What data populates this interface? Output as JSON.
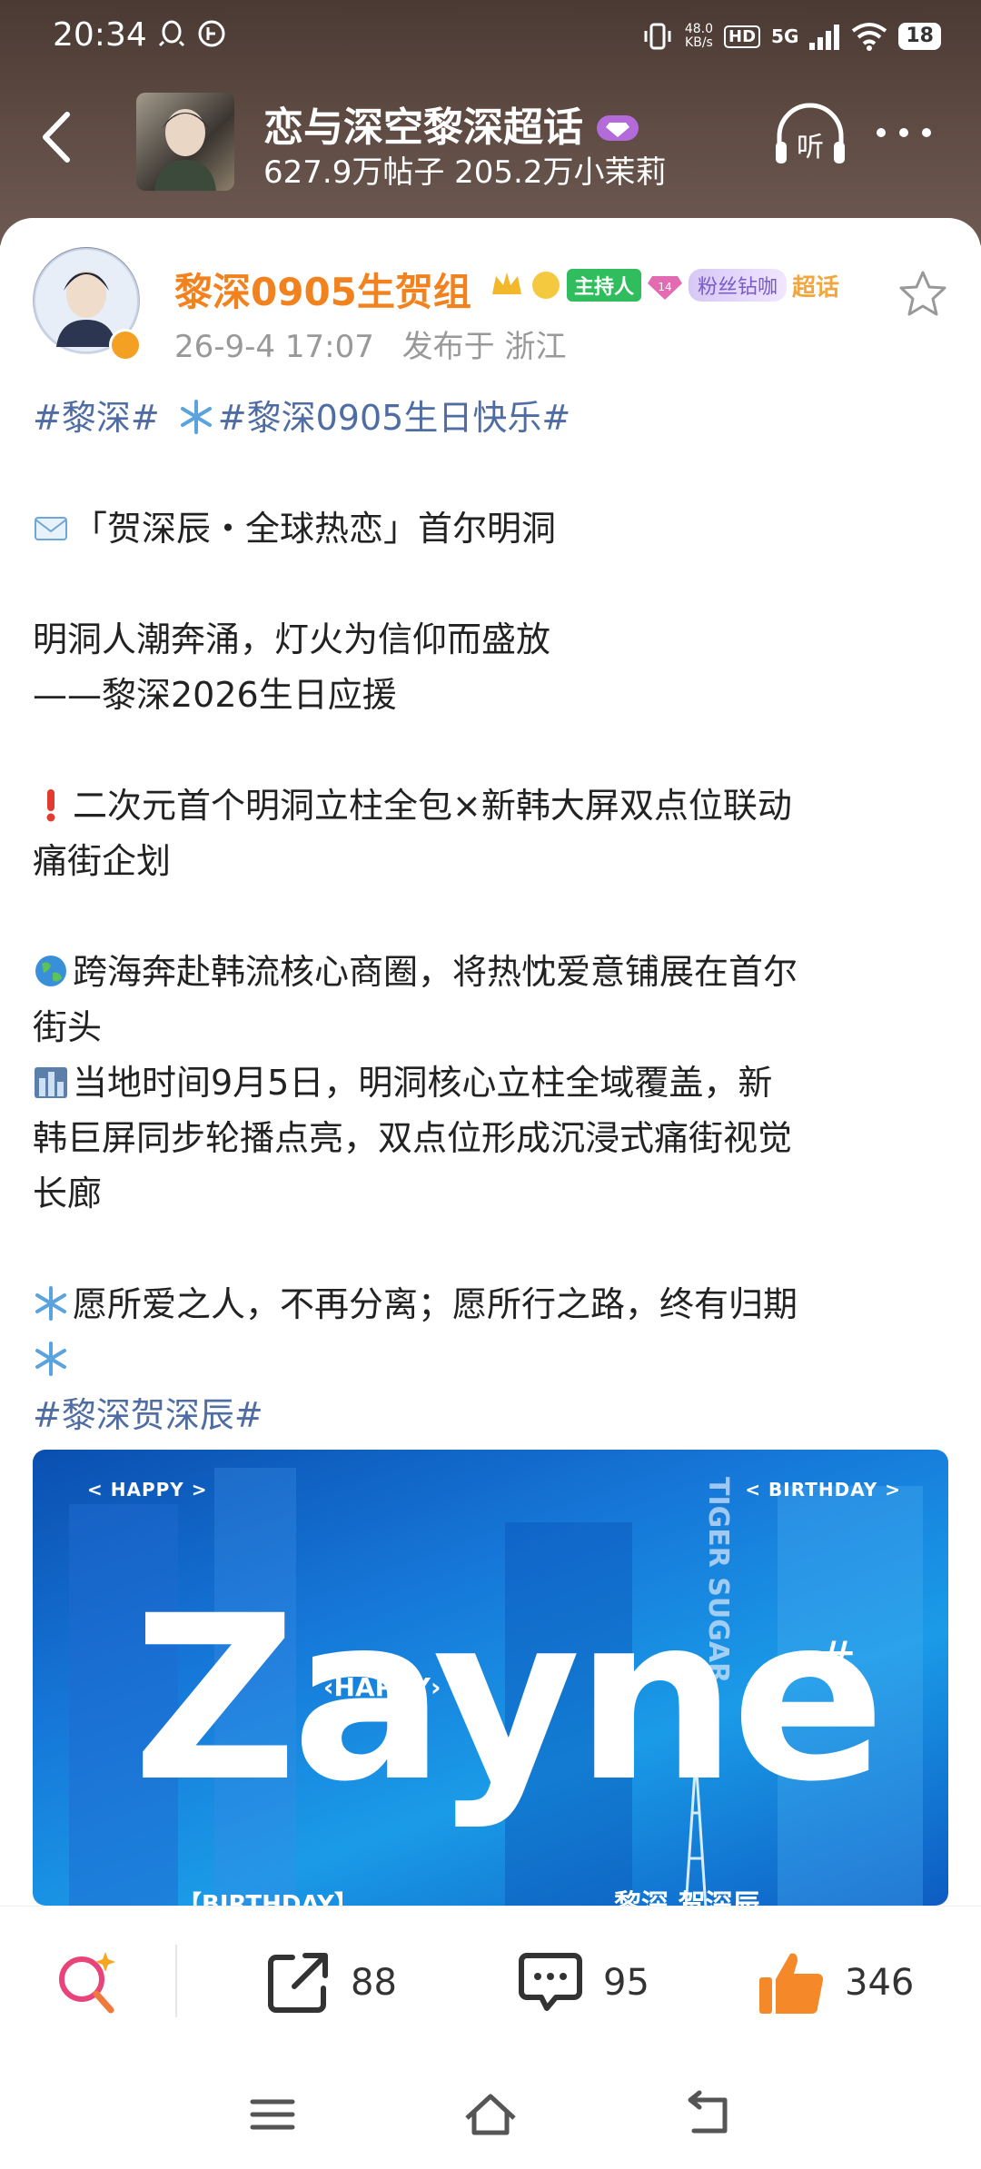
{
  "status_bar": {
    "time": "20:34",
    "net_speed_value": "48.0",
    "net_speed_unit": "KB/s",
    "hd": "HD",
    "signal": "5G",
    "battery": "18"
  },
  "topic": {
    "title": "恋与深空黎深超话",
    "posts": "627.9万帖子",
    "members": "205.2万小茉莉",
    "listen_label": "听"
  },
  "post": {
    "author": "黎深0905生贺组",
    "badge_host": "主持人",
    "badge_level": "14",
    "badge_fan": "粉丝钻咖",
    "badge_chaohua": "超话",
    "date": "26-9-4 17:07",
    "location": "发布于 浙江",
    "lines": {
      "l1_tag1": "#黎深#",
      "l1_tag2": "#黎深0905生日快乐#",
      "l2": "「贺深辰・全球热恋」首尔明洞",
      "l3": "明洞人潮奔涌，灯火为信仰而盛放",
      "l4": "——黎深2026生日应援",
      "l5a": "二次元首个明洞立柱全包×新韩大屏双点位联动",
      "l5b": "痛街企划",
      "l6a": "跨海奔赴韩流核心商圈，将热忱爱意铺展在首尔",
      "l6b": "街头",
      "l7a": "当地时间9月5日，明洞核心立柱全域覆盖，新",
      "l7b": "韩巨屏同步轮播点亮，双点位形成沉浸式痛街视觉",
      "l7c": "长廊",
      "l8": "愿所爱之人，不再分离；愿所行之路，终有归期",
      "l9_tag": "#黎深贺深辰#"
    },
    "image": {
      "happy_tag": "< HAPPY >",
      "birthday_tag": "< BIRTHDAY >",
      "happy_small": "‹HAPPY›",
      "name": "Zayne",
      "hash": "#",
      "sign": "TIGER SUGAR",
      "bottom_left": "【BIRTHDAY】",
      "bottom_right": "黎深 贺深辰"
    }
  },
  "actions": {
    "share_count": "88",
    "comment_count": "95",
    "like_count": "346"
  },
  "colors": {
    "author": "#f2821e",
    "hashtag": "#4f6da3",
    "like": "#f5892a"
  }
}
